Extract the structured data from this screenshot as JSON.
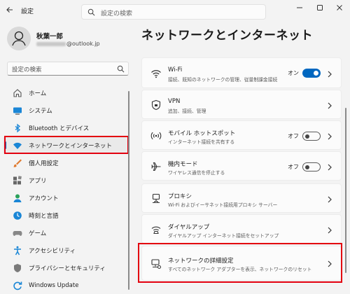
{
  "app": {
    "title": "設定"
  },
  "search": {
    "top_placeholder": "設定の検索",
    "side_placeholder": "設定の検索"
  },
  "user": {
    "name": "秋葉一郎",
    "email_suffix": "@outlook.jp"
  },
  "nav": {
    "items": [
      {
        "label": "ホーム",
        "icon": "home-icon"
      },
      {
        "label": "システム",
        "icon": "system-icon"
      },
      {
        "label": "Bluetooth とデバイス",
        "icon": "bluetooth-icon"
      },
      {
        "label": "ネットワークとインターネット",
        "icon": "network-icon",
        "selected": true
      },
      {
        "label": "個人用設定",
        "icon": "brush-icon"
      },
      {
        "label": "アプリ",
        "icon": "apps-icon"
      },
      {
        "label": "アカウント",
        "icon": "account-icon"
      },
      {
        "label": "時刻と言語",
        "icon": "time-language-icon"
      },
      {
        "label": "ゲーム",
        "icon": "gamepad-icon"
      },
      {
        "label": "アクセシビリティ",
        "icon": "accessibility-icon"
      },
      {
        "label": "プライバシーとセキュリティ",
        "icon": "shield-icon"
      },
      {
        "label": "Windows Update",
        "icon": "update-icon"
      }
    ]
  },
  "page": {
    "title": "ネットワークとインターネット"
  },
  "cards": [
    {
      "title": "Wi-Fi",
      "subtitle": "接続、既知のネットワークの管理、従量制課金接続",
      "state": "オン",
      "toggle": "on",
      "icon": "wifi-icon"
    },
    {
      "title": "VPN",
      "subtitle": "追加、接続、管理",
      "icon": "vpn-shield-icon"
    },
    {
      "title": "モバイル ホットスポット",
      "subtitle": "インターネット接続を共有する",
      "state": "オフ",
      "toggle": "off",
      "icon": "hotspot-icon"
    },
    {
      "title": "機内モード",
      "subtitle": "ワイヤレス通信を停止する",
      "state": "オフ",
      "toggle": "off",
      "icon": "airplane-icon"
    },
    {
      "title": "プロキシ",
      "subtitle": "Wi-Fi およびイーサネット接続用プロキシ サーバー",
      "icon": "proxy-icon"
    },
    {
      "title": "ダイヤルアップ",
      "subtitle": "ダイヤルアップ インターネット接続をセットアップ",
      "icon": "dialup-icon"
    },
    {
      "title": "ネットワークの詳細設定",
      "subtitle": "すべてのネットワーク アダプターを表示、ネットワークのリセット",
      "icon": "advanced-network-icon"
    }
  ],
  "colors": {
    "accent": "#0067c0",
    "highlight": "#e3000f",
    "background": "#f3f3f3",
    "card": "#fbfbfb"
  }
}
